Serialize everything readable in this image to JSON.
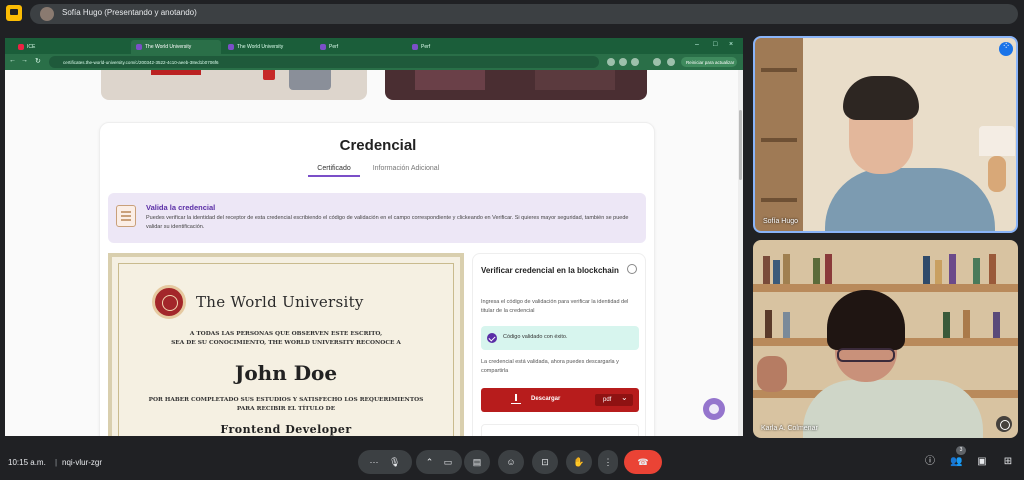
{
  "presenter_bar": {
    "label": "Sofía Hugo (Presentando y anotando)"
  },
  "browser": {
    "tabs": [
      {
        "label": "ICE",
        "active": false
      },
      {
        "label": "The World University",
        "active": true
      },
      {
        "label": "The World University",
        "active": false
      },
      {
        "label": "Perf",
        "active": false
      },
      {
        "label": "Perf",
        "active": false
      }
    ],
    "url": "certificates.the-world-university.com/c/200342-3522-4c10-aeeb-38ed1b0706f6",
    "resume_label": "Reiniciar para actualizar"
  },
  "page": {
    "card_title": "Credencial",
    "tab_certificate": "Certificado",
    "tab_info": "Información Adicional",
    "validate_title": "Valida la credencial",
    "validate_text": "Puedes verificar la identidad del receptor de esta credencial escribiendo el código de validación en el campo correspondiente y clickeando en Verificar. Si quieres mayor seguridad, también se puede validar su identificación.",
    "certificate": {
      "university": "The World University",
      "line1": "A TODAS LAS PERSONAS QUE OBSERVEN ESTE ESCRITO,",
      "line2": "SEA DE SU CONOCIMIENTO, THE WORLD UNIVERSITY RECONOCE A",
      "recipient": "John Doe",
      "line3": "POR HABER COMPLETADO SUS ESTUDIOS Y SATISFECHO LOS REQUERIMIENTOS",
      "line4": "PARA RECIBIR EL TÍTULO DE",
      "degree": "Frontend Developer"
    },
    "verify": {
      "title": "Verificar credencial en la blockchain",
      "desc": "Ingresa el código de validación para verificar la identidad del titular de la credencial",
      "success": "Código validado con éxito.",
      "note": "La credencial está validada, ahora puedes descargarla y compartirla",
      "download_label": "Descargar",
      "format": "pdf"
    }
  },
  "participants": [
    {
      "name": "Sofía Hugo"
    },
    {
      "name": "Karla A. Colmenar"
    }
  ],
  "meeting": {
    "time": "10:15 a.m.",
    "separator": "|",
    "code": "nqi-vlur-zgr",
    "participant_count": "3"
  },
  "controls": {
    "more": "···",
    "mic": "🎙",
    "chevron": "⌃",
    "camera": "▭",
    "captions": "▤",
    "emoji": "☺",
    "present": "⊡",
    "hand": "✋",
    "options": "⋮",
    "end": "☎",
    "info": "ⓘ",
    "people": "👥",
    "chat": "▣",
    "activities": "⊞"
  }
}
